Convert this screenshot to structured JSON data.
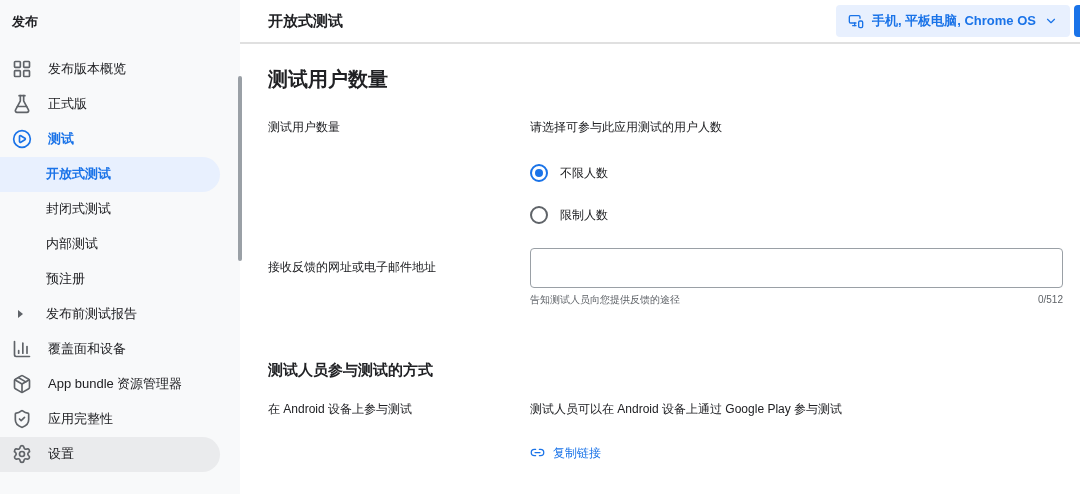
{
  "sidebar": {
    "title": "发布",
    "items": [
      {
        "label": "发布版本概览",
        "selected": false,
        "hovered": false
      },
      {
        "label": "正式版",
        "selected": false,
        "hovered": false
      },
      {
        "label": "测试",
        "selected": false,
        "hovered": false,
        "expanded": true,
        "children": [
          {
            "label": "开放式测试",
            "selected": true
          },
          {
            "label": "封闭式测试",
            "selected": false
          },
          {
            "label": "内部测试",
            "selected": false
          },
          {
            "label": "预注册",
            "selected": false
          },
          {
            "label": "发布前测试报告",
            "selected": false,
            "expanded": false
          }
        ]
      },
      {
        "label": "覆盖面和设备",
        "selected": false,
        "hovered": false
      },
      {
        "label": "App bundle 资源管理器",
        "selected": false,
        "hovered": false
      },
      {
        "label": "应用完整性",
        "selected": false,
        "hovered": false
      },
      {
        "label": "设置",
        "selected": false,
        "hovered": true
      }
    ]
  },
  "header": {
    "title": "开放式测试",
    "device_selector": "手机, 平板电脑, Chrome OS"
  },
  "section_1": {
    "heading": "测试用户数量",
    "label": "测试用户数量",
    "description": "请选择可参与此应用测试的用户人数",
    "options": [
      {
        "label": "不限人数",
        "selected": true
      },
      {
        "label": "限制人数",
        "selected": false
      }
    ],
    "feedback_label": "接收反馈的网址或电子邮件地址",
    "feedback_helper": "告知测试人员向您提供反馈的途径",
    "feedback_counter": "0/512"
  },
  "section_2": {
    "heading": "测试人员参与测试的方式",
    "label": "在 Android 设备上参与测试",
    "description": "测试人员可以在 Android 设备上通过 Google Play 参与测试",
    "link": "复制链接"
  }
}
